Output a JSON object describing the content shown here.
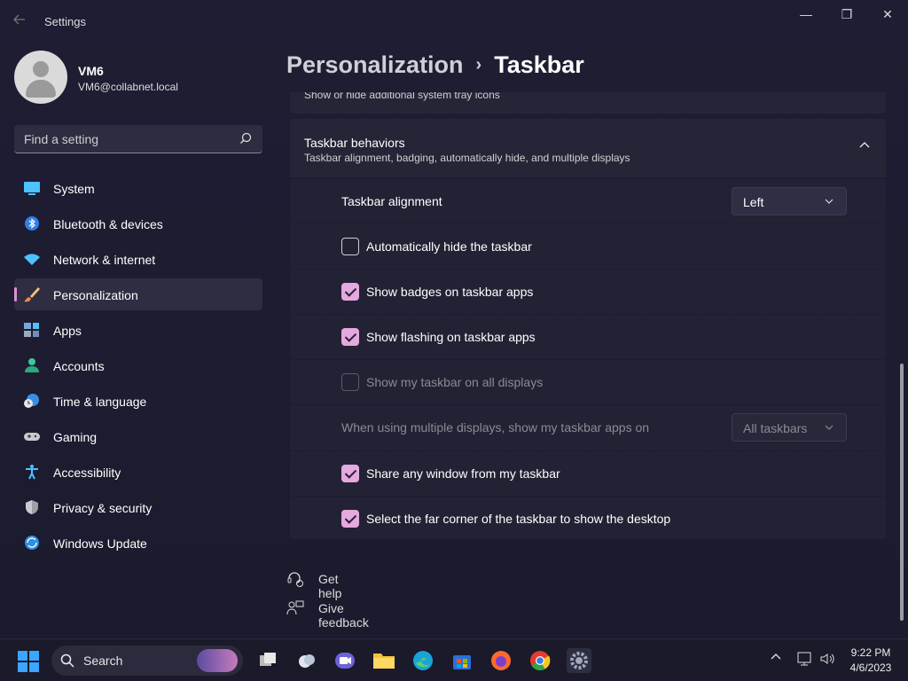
{
  "window": {
    "title": "Settings",
    "back_icon": "back-arrow-icon",
    "minimize": "—",
    "maximize": "❐",
    "close": "✕"
  },
  "user": {
    "name": "VM6",
    "email": "VM6@collabnet.local"
  },
  "search": {
    "placeholder": "Find a setting"
  },
  "nav": [
    {
      "label": "System",
      "icon": "system-icon"
    },
    {
      "label": "Bluetooth & devices",
      "icon": "bluetooth-icon"
    },
    {
      "label": "Network & internet",
      "icon": "wifi-icon"
    },
    {
      "label": "Personalization",
      "icon": "brush-icon",
      "active": true
    },
    {
      "label": "Apps",
      "icon": "apps-icon"
    },
    {
      "label": "Accounts",
      "icon": "accounts-icon"
    },
    {
      "label": "Time & language",
      "icon": "clock-globe-icon"
    },
    {
      "label": "Gaming",
      "icon": "gamepad-icon"
    },
    {
      "label": "Accessibility",
      "icon": "accessibility-icon"
    },
    {
      "label": "Privacy & security",
      "icon": "shield-icon"
    },
    {
      "label": "Windows Update",
      "icon": "update-icon"
    }
  ],
  "breadcrumb": {
    "parent": "Personalization",
    "separator": "›",
    "current": "Taskbar"
  },
  "prev_section_subtitle": "Show or hide additional system tray icons",
  "behaviors": {
    "title": "Taskbar behaviors",
    "subtitle": "Taskbar alignment, badging, automatically hide, and multiple displays",
    "expanded": true,
    "alignment": {
      "label": "Taskbar alignment",
      "value": "Left"
    },
    "options": [
      {
        "label": "Automatically hide the taskbar",
        "checked": false,
        "enabled": true
      },
      {
        "label": "Show badges on taskbar apps",
        "checked": true,
        "enabled": true
      },
      {
        "label": "Show flashing on taskbar apps",
        "checked": true,
        "enabled": true
      },
      {
        "label": "Show my taskbar on all displays",
        "checked": false,
        "enabled": false
      }
    ],
    "multi_display": {
      "label": "When using multiple displays, show my taskbar apps on",
      "value": "All taskbars",
      "enabled": false
    },
    "options2": [
      {
        "label": "Share any window from my taskbar",
        "checked": true,
        "enabled": true
      },
      {
        "label": "Select the far corner of the taskbar to show the desktop",
        "checked": true,
        "enabled": true
      }
    ]
  },
  "links": {
    "help": "Get help",
    "feedback": "Give feedback"
  },
  "taskbar": {
    "search_label": "Search",
    "apps": [
      "start-icon",
      "task-view-icon",
      "widgets-icon",
      "teams-chat-icon",
      "file-explorer-icon",
      "edge-icon",
      "store-icon",
      "firefox-icon",
      "chrome-icon",
      "settings-icon"
    ],
    "time": "9:22 PM",
    "date": "4/6/2023"
  },
  "colors": {
    "accent": "#e5a8df",
    "bg": "#1c1b2e",
    "card": "#232235"
  }
}
